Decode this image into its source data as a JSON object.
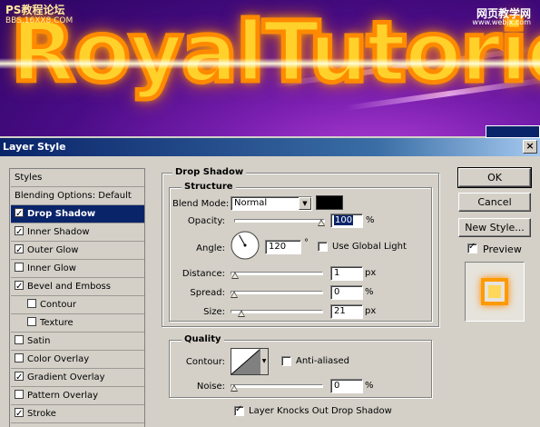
{
  "banner": {
    "title": "RoyalTutoric",
    "watermark_left": "PS教程论坛",
    "watermark_left_sub": "BBS.16XX8.COM",
    "watermark_right": "网页教学网",
    "watermark_right_sub": "www.webjx.com"
  },
  "dialog": {
    "title": "Layer Style",
    "close_glyph": "×",
    "styles_header": "Styles",
    "style_items": [
      {
        "label": "Blending Options: Default",
        "checkbox": false,
        "checked": false,
        "indent": false,
        "selected": false
      },
      {
        "label": "Drop Shadow",
        "checkbox": true,
        "checked": true,
        "indent": false,
        "selected": true
      },
      {
        "label": "Inner Shadow",
        "checkbox": true,
        "checked": true,
        "indent": false,
        "selected": false
      },
      {
        "label": "Outer Glow",
        "checkbox": true,
        "checked": true,
        "indent": false,
        "selected": false
      },
      {
        "label": "Inner Glow",
        "checkbox": true,
        "checked": false,
        "indent": false,
        "selected": false
      },
      {
        "label": "Bevel and Emboss",
        "checkbox": true,
        "checked": true,
        "indent": false,
        "selected": false
      },
      {
        "label": "Contour",
        "checkbox": true,
        "checked": false,
        "indent": true,
        "selected": false
      },
      {
        "label": "Texture",
        "checkbox": true,
        "checked": false,
        "indent": true,
        "selected": false
      },
      {
        "label": "Satin",
        "checkbox": true,
        "checked": false,
        "indent": false,
        "selected": false
      },
      {
        "label": "Color Overlay",
        "checkbox": true,
        "checked": false,
        "indent": false,
        "selected": false
      },
      {
        "label": "Gradient Overlay",
        "checkbox": true,
        "checked": true,
        "indent": false,
        "selected": false
      },
      {
        "label": "Pattern Overlay",
        "checkbox": true,
        "checked": false,
        "indent": false,
        "selected": false
      },
      {
        "label": "Stroke",
        "checkbox": true,
        "checked": true,
        "indent": false,
        "selected": false
      }
    ],
    "drop_shadow": {
      "section_title": "Drop Shadow",
      "structure_title": "Structure",
      "blend_mode_label": "Blend Mode:",
      "blend_mode_value": "Normal",
      "shadow_color": "#000000",
      "opacity_label": "Opacity:",
      "opacity_value": "100",
      "opacity_unit": "%",
      "opacity_fraction": 1.0,
      "angle_label": "Angle:",
      "angle_value": "120",
      "angle_unit": "°",
      "use_global_light_label": "Use Global Light",
      "use_global_light_checked": false,
      "distance_label": "Distance:",
      "distance_value": "1",
      "distance_unit": "px",
      "distance_fraction": 0.01,
      "spread_label": "Spread:",
      "spread_value": "0",
      "spread_unit": "%",
      "spread_fraction": 0.0,
      "size_label": "Size:",
      "size_value": "21",
      "size_unit": "px",
      "size_fraction": 0.08,
      "quality_title": "Quality",
      "contour_label": "Contour:",
      "anti_aliased_label": "Anti-aliased",
      "anti_aliased_checked": false,
      "noise_label": "Noise:",
      "noise_value": "0",
      "noise_unit": "%",
      "noise_fraction": 0.0,
      "knockout_label": "Layer Knocks Out Drop Shadow",
      "knockout_checked": true
    },
    "buttons": {
      "ok": "OK",
      "cancel": "Cancel",
      "new_style": "New Style...",
      "preview_label": "Preview",
      "preview_checked": true
    },
    "colors": {
      "selection": "#0a246a",
      "dialog_bg": "#d4d0c8",
      "preview_swatch": "#ffc21a"
    }
  }
}
